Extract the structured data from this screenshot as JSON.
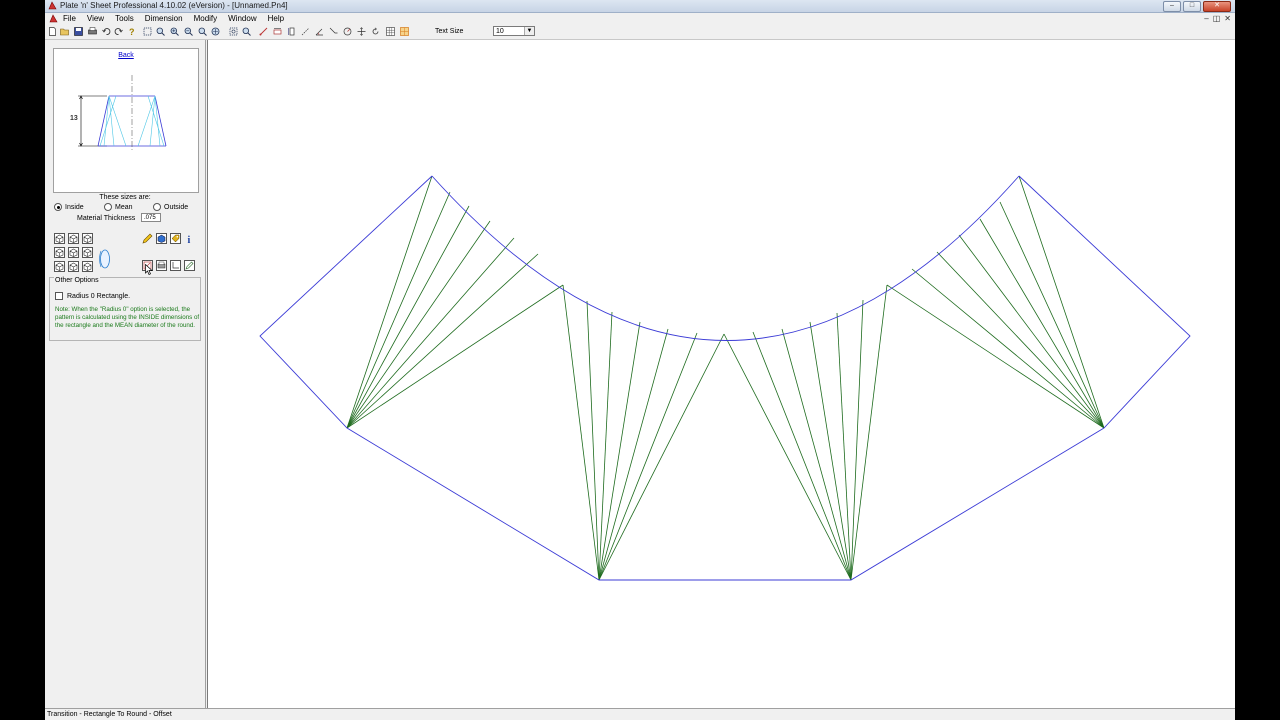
{
  "window": {
    "title": "Plate 'n' Sheet Professional 4.10.02 (eVersion) - [Unnamed.Pn4]",
    "controls": [
      "–",
      "□",
      "✕"
    ]
  },
  "menu": {
    "items": [
      "File",
      "View",
      "Tools",
      "Dimension",
      "Modify",
      "Window",
      "Help"
    ],
    "mdi_controls": [
      "–",
      "◫",
      "✕"
    ]
  },
  "toolbar": {
    "text_size_label": "Text Size",
    "text_size_value": "10"
  },
  "preview": {
    "back_link": "Back",
    "dimension_label": "13"
  },
  "sizes": {
    "heading": "These sizes are:",
    "options": [
      "Inside",
      "Mean",
      "Outside"
    ],
    "selected": "Inside",
    "material_thickness_label": "Material Thickness",
    "material_thickness_value": ".075"
  },
  "other_options": {
    "legend": "Other Options",
    "radius_checkbox_label": "Radius 0 Rectangle.",
    "radius_checked": false,
    "note": "Note:  When the \"Radius 0\" option is selected, the pattern is calculated using the INSIDE dimensions of the rectangle and the MEAN diameter of the round."
  },
  "status": {
    "text": "Transition - Rectangle To Round - Offset"
  },
  "colors": {
    "pattern_outline": "#3b3bd6",
    "pattern_lines": "#1e6b1e"
  }
}
